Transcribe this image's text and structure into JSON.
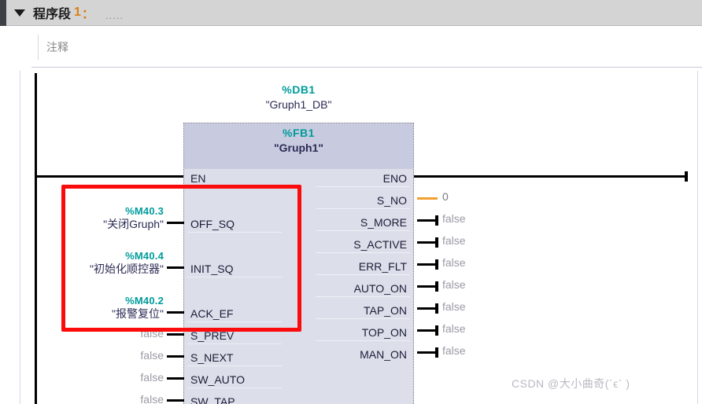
{
  "network": {
    "collapse_icon": "triangle-down-icon",
    "title": "程序段",
    "number": "1",
    "colon": "：",
    "dots": "....."
  },
  "comment": {
    "placeholder": "注释",
    "value": ""
  },
  "block": {
    "db_number": "%DB1",
    "db_name": "\"Gruph1_DB\"",
    "fb_number": "%FB1",
    "fb_name": "\"Gruph1\"",
    "inputs": [
      {
        "pin": "EN",
        "operand_addr": "",
        "operand_name": "",
        "value": ""
      },
      {
        "pin": "OFF_SQ",
        "operand_addr": "%M40.3",
        "operand_name": "\"关闭Gruph\"",
        "value": ""
      },
      {
        "pin": "INIT_SQ",
        "operand_addr": "%M40.4",
        "operand_name": "\"初始化顺控器\"",
        "value": ""
      },
      {
        "pin": "ACK_EF",
        "operand_addr": "%M40.2",
        "operand_name": "\"报警复位\"",
        "value": ""
      },
      {
        "pin": "S_PREV",
        "operand_addr": "",
        "operand_name": "",
        "value": "false"
      },
      {
        "pin": "S_NEXT",
        "operand_addr": "",
        "operand_name": "",
        "value": "false"
      },
      {
        "pin": "SW_AUTO",
        "operand_addr": "",
        "operand_name": "",
        "value": "false"
      },
      {
        "pin": "SW_TAP",
        "operand_addr": "",
        "operand_name": "",
        "value": "false"
      }
    ],
    "outputs": [
      {
        "pin": "ENO",
        "value": "",
        "wire": "rail"
      },
      {
        "pin": "S_NO",
        "value": "0",
        "wire": "orange"
      },
      {
        "pin": "S_MORE",
        "value": "false",
        "wire": "black"
      },
      {
        "pin": "S_ACTIVE",
        "value": "false",
        "wire": "black"
      },
      {
        "pin": "ERR_FLT",
        "value": "false",
        "wire": "black"
      },
      {
        "pin": "AUTO_ON",
        "value": "false",
        "wire": "black"
      },
      {
        "pin": "TAP_ON",
        "value": "false",
        "wire": "black"
      },
      {
        "pin": "TOP_ON",
        "value": "false",
        "wire": "black"
      },
      {
        "pin": "MAN_ON",
        "value": "false",
        "wire": "black"
      }
    ]
  },
  "annotation": {
    "highlight_color": "#fb0b0b",
    "shape": "rectangle"
  },
  "watermark": {
    "text": "CSDN @大小曲奇(´ϵ`  )"
  },
  "colors": {
    "header_bg": "#d4d4d4",
    "block_title_bg": "#c8cbdf",
    "block_body_bg": "#dcdee9",
    "address_teal": "#009b9b",
    "accent_orange": "#d98014",
    "wire_orange": "#f0a030",
    "value_gray": "#9a9aa6"
  }
}
